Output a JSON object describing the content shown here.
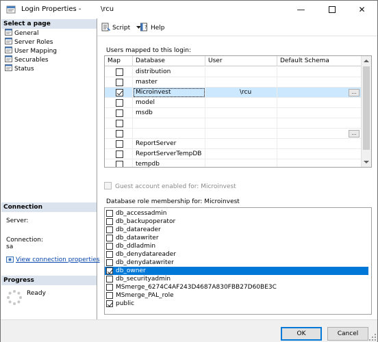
{
  "window": {
    "title": "Login Properties - ",
    "title_user": "\\rcu",
    "minimize_glyph": "—",
    "close_glyph": "✕"
  },
  "left_pane": {
    "select_page_header": "Select a page",
    "pages": [
      {
        "label": "General",
        "icon": "page-icon"
      },
      {
        "label": "Server Roles",
        "icon": "page-icon"
      },
      {
        "label": "User Mapping",
        "icon": "page-icon"
      },
      {
        "label": "Securables",
        "icon": "page-icon"
      },
      {
        "label": "Status",
        "icon": "page-icon"
      }
    ],
    "connection_header": "Connection",
    "server_label": "Server:",
    "connection_label": "Connection:",
    "connection_value": "sa",
    "view_connection_link": "View connection properties",
    "progress_header": "Progress",
    "progress_status": "Ready"
  },
  "toolbar": {
    "script_label": "Script",
    "help_label": "Help"
  },
  "users_mapped": {
    "label": "Users mapped to this login:",
    "columns": [
      "Map",
      "Database",
      "User",
      "Default Schema"
    ],
    "rows": [
      {
        "map": false,
        "database": "distribution",
        "user": "",
        "schema": "",
        "ellipsis": false
      },
      {
        "map": false,
        "database": "master",
        "user": "",
        "schema": "",
        "ellipsis": false
      },
      {
        "map": true,
        "database": "Microinvest",
        "user": "\\rcu",
        "schema": "",
        "ellipsis": true,
        "selected": true
      },
      {
        "map": false,
        "database": "model",
        "user": "",
        "schema": "",
        "ellipsis": false
      },
      {
        "map": false,
        "database": "msdb",
        "user": "",
        "schema": "",
        "ellipsis": false
      },
      {
        "map": false,
        "database": "",
        "user": "",
        "schema": "",
        "ellipsis": false
      },
      {
        "map": false,
        "database": "",
        "user": "",
        "schema": "",
        "ellipsis": true
      },
      {
        "map": false,
        "database": "ReportServer",
        "user": "",
        "schema": "",
        "ellipsis": false
      },
      {
        "map": false,
        "database": "ReportServerTempDB",
        "user": "",
        "schema": "",
        "ellipsis": false
      },
      {
        "map": false,
        "database": "tempdb",
        "user": "",
        "schema": "",
        "ellipsis": false
      }
    ]
  },
  "guest_account": {
    "label": "Guest account enabled for: Microinvest",
    "checked": false,
    "enabled": false
  },
  "role_membership": {
    "label": "Database role membership for: Microinvest",
    "roles": [
      {
        "name": "db_accessadmin",
        "checked": false
      },
      {
        "name": "db_backupoperator",
        "checked": false
      },
      {
        "name": "db_datareader",
        "checked": false
      },
      {
        "name": "db_datawriter",
        "checked": false
      },
      {
        "name": "db_ddladmin",
        "checked": false
      },
      {
        "name": "db_denydatareader",
        "checked": false
      },
      {
        "name": "db_denydatawriter",
        "checked": false
      },
      {
        "name": "db_owner",
        "checked": true,
        "selected": true
      },
      {
        "name": "db_securityadmin",
        "checked": false
      },
      {
        "name": "MSmerge_6274C4AF243D4687A830FBB27D60BE3C",
        "checked": false
      },
      {
        "name": "MSmerge_PAL_role",
        "checked": false
      },
      {
        "name": "public",
        "checked": true
      }
    ]
  },
  "buttons": {
    "ok_label": "OK",
    "cancel_label": "Cancel"
  },
  "colors": {
    "selection": "#0078d7",
    "grid_selection": "#cce8ff",
    "section_header": "#dbe3ee",
    "link": "#0645ad"
  }
}
